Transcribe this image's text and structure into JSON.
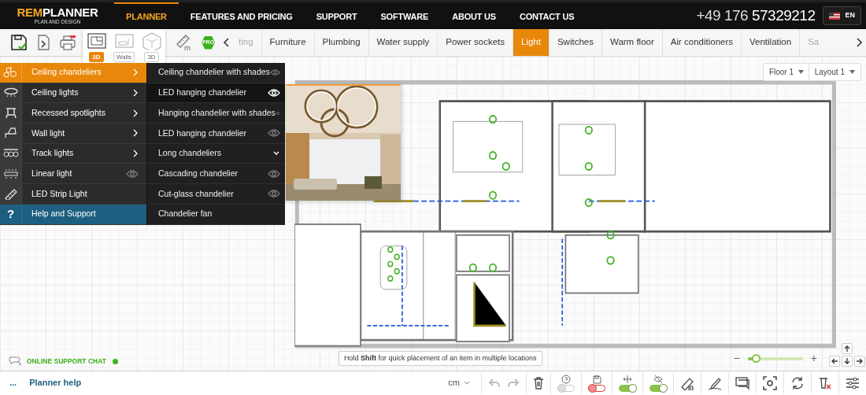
{
  "header": {
    "logo": {
      "accent": "REM",
      "main": "PLANNER",
      "tagline": "PLAN AND DESIGN"
    },
    "nav": [
      {
        "label": "PLANNER",
        "selected": true
      },
      {
        "label": "FEATURES AND PRICING",
        "selected": false
      },
      {
        "label": "SUPPORT",
        "selected": false
      },
      {
        "label": "SOFTWARE",
        "selected": false
      },
      {
        "label": "ABOUT US",
        "selected": false
      },
      {
        "label": "CONTACT US",
        "selected": false
      }
    ],
    "phone": "+49 176 **57329212**",
    "language": "EN"
  },
  "toolbar": {
    "view_modes": [
      {
        "label": "2D",
        "selected": true
      },
      {
        "label": "Walls",
        "selected": false
      },
      {
        "label": "3D",
        "selected": false
      }
    ],
    "pro_badge": "PRO",
    "tabs": [
      {
        "label": "ting",
        "selected": false,
        "faded": true
      },
      {
        "label": "Furniture",
        "selected": false,
        "faded": false
      },
      {
        "label": "Plumbing",
        "selected": false,
        "faded": false
      },
      {
        "label": "Water supply",
        "selected": false,
        "faded": false
      },
      {
        "label": "Power sockets",
        "selected": false,
        "faded": false
      },
      {
        "label": "Light",
        "selected": true,
        "faded": false
      },
      {
        "label": "Switches",
        "selected": false,
        "faded": false
      },
      {
        "label": "Warm floor",
        "selected": false,
        "faded": false
      },
      {
        "label": "Air conditioners",
        "selected": false,
        "faded": false
      },
      {
        "label": "Ventilation",
        "selected": false,
        "faded": false
      },
      {
        "label": "Sa",
        "selected": false,
        "faded": true
      }
    ]
  },
  "canvas": {
    "dropdowns": [
      "Floor 1",
      "Layout 1"
    ],
    "categories": [
      {
        "label": "Ceiling chandeliers",
        "kind": "submenu",
        "selected": true
      },
      {
        "label": "Ceiling lights",
        "kind": "submenu",
        "selected": false
      },
      {
        "label": "Recessed spotlights",
        "kind": "submenu",
        "selected": false
      },
      {
        "label": "Wall light",
        "kind": "submenu",
        "selected": false
      },
      {
        "label": "Track lights",
        "kind": "submenu",
        "selected": false
      },
      {
        "label": "Linear light",
        "kind": "eye",
        "selected": false
      },
      {
        "label": "LED Strip Light",
        "kind": "plain",
        "selected": false
      },
      {
        "label": "Help and Support",
        "kind": "help",
        "selected": false,
        "icon_text": "?"
      }
    ],
    "subitems": [
      {
        "label": "Ceiling chandelier with shades",
        "kind": "eye",
        "selected": false
      },
      {
        "label": "LED hanging chandelier",
        "kind": "eye",
        "selected": true
      },
      {
        "label": "Hanging chandelier with shades",
        "kind": "eye",
        "selected": false
      },
      {
        "label": "LED hanging chandelier",
        "kind": "eye",
        "selected": false
      },
      {
        "label": "Long chandeliers",
        "kind": "expand",
        "selected": false
      },
      {
        "label": "Cascading chandelier",
        "kind": "eye",
        "selected": false
      },
      {
        "label": "Cut-glass chandelier",
        "kind": "eye",
        "selected": false
      },
      {
        "label": "Chandelier fan",
        "kind": "plain",
        "selected": false
      }
    ],
    "preview": {
      "kind": "picture"
    },
    "support_chat": {
      "label": "ONLINE SUPPORT CHAT",
      "online": true
    },
    "hint": "Hold **Shift** for quick placement of an item in multiple locations",
    "zoom": {
      "minus": "−",
      "plus": "+",
      "level": 0.15
    }
  },
  "bottom_bar": {
    "more": "...",
    "help_link": "Planner help",
    "unit": "cm",
    "toggles": [
      {
        "on": false,
        "color": "#c8c8c8"
      },
      {
        "on": false,
        "color": "#e53935"
      },
      {
        "on": true,
        "color": "#8bc34a"
      },
      {
        "on": true,
        "color": "#8bc34a"
      }
    ]
  }
}
